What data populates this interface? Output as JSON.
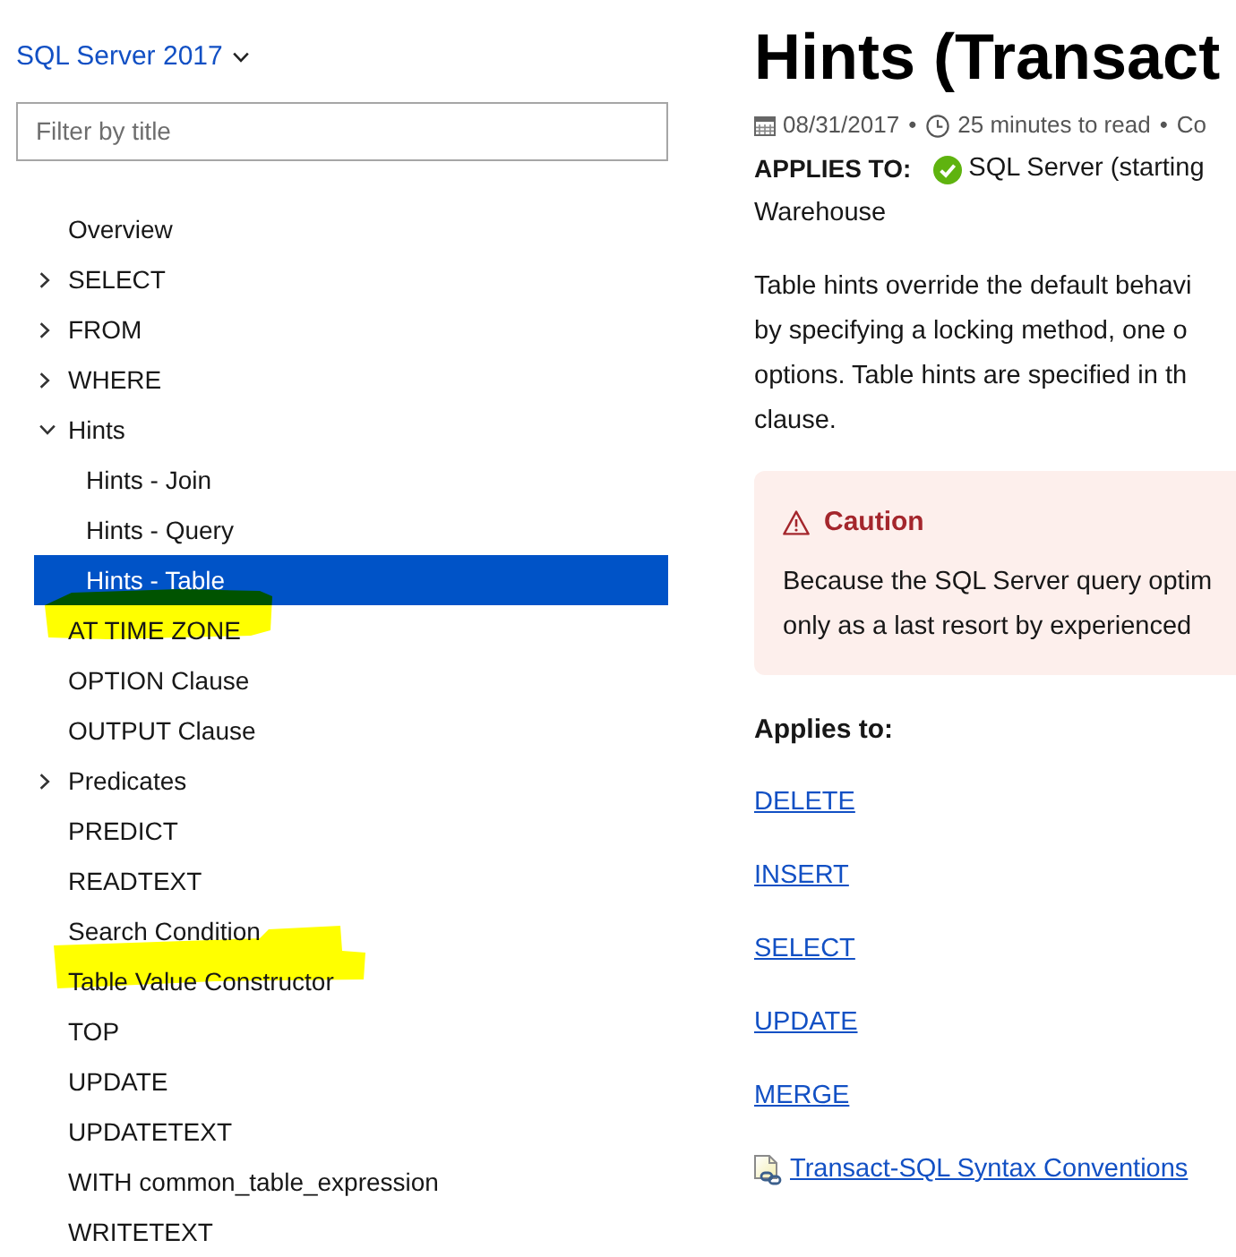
{
  "sidebar": {
    "version_selector": "SQL Server 2017",
    "filter": {
      "placeholder": "Filter by title"
    },
    "tree": [
      {
        "label": "Overview",
        "selected": false
      },
      {
        "label": "SELECT",
        "expanded": false,
        "selected": false
      },
      {
        "label": "FROM",
        "expanded": false,
        "selected": false
      },
      {
        "label": "WHERE",
        "expanded": false,
        "selected": false
      },
      {
        "label": "Hints",
        "expanded": true,
        "selected": false,
        "children": [
          {
            "label": "Hints - Join",
            "selected": false
          },
          {
            "label": "Hints - Query",
            "selected": false
          },
          {
            "label": "Hints - Table",
            "selected": true
          }
        ]
      },
      {
        "label": "AT TIME ZONE",
        "selected": false
      },
      {
        "label": "OPTION Clause",
        "selected": false
      },
      {
        "label": "OUTPUT Clause",
        "selected": false
      },
      {
        "label": "Predicates",
        "expanded": false,
        "selected": false
      },
      {
        "label": "PREDICT",
        "selected": false
      },
      {
        "label": "READTEXT",
        "selected": false
      },
      {
        "label": "Search Condition",
        "selected": false
      },
      {
        "label": "Table Value Constructor",
        "selected": false
      },
      {
        "label": "TOP",
        "selected": false
      },
      {
        "label": "UPDATE",
        "selected": false
      },
      {
        "label": "UPDATETEXT",
        "selected": false
      },
      {
        "label": "WITH common_table_expression",
        "selected": false
      },
      {
        "label": "WRITETEXT",
        "selected": false
      }
    ]
  },
  "article": {
    "title": "Hints (Transact",
    "meta": [
      {
        "kind": "date",
        "text": "08/31/2017"
      },
      {
        "kind": "separator",
        "text": "•"
      },
      {
        "kind": "reading_time",
        "text": "25 minutes to read"
      },
      {
        "kind": "separator",
        "text": "•"
      },
      {
        "kind": "text",
        "text": "Co"
      }
    ],
    "applies_to": {
      "label": "APPLIES TO:",
      "supported": true,
      "lines": [
        "SQL Server (starting",
        "Warehouse"
      ]
    },
    "intro_lines": [
      "Table hints override the default behavi",
      "by specifying a locking method, one o",
      "options. Table hints are specified in th",
      "clause."
    ],
    "caution": {
      "title": "Caution",
      "lines": [
        "Because the SQL Server query optim",
        "only as a last resort by experienced"
      ]
    },
    "applies_heading": "Applies to:",
    "links": [
      "DELETE",
      "INSERT",
      "SELECT",
      "UPDATE",
      "MERGE"
    ],
    "syntax_link": "Transact-SQL Syntax Conventions"
  }
}
